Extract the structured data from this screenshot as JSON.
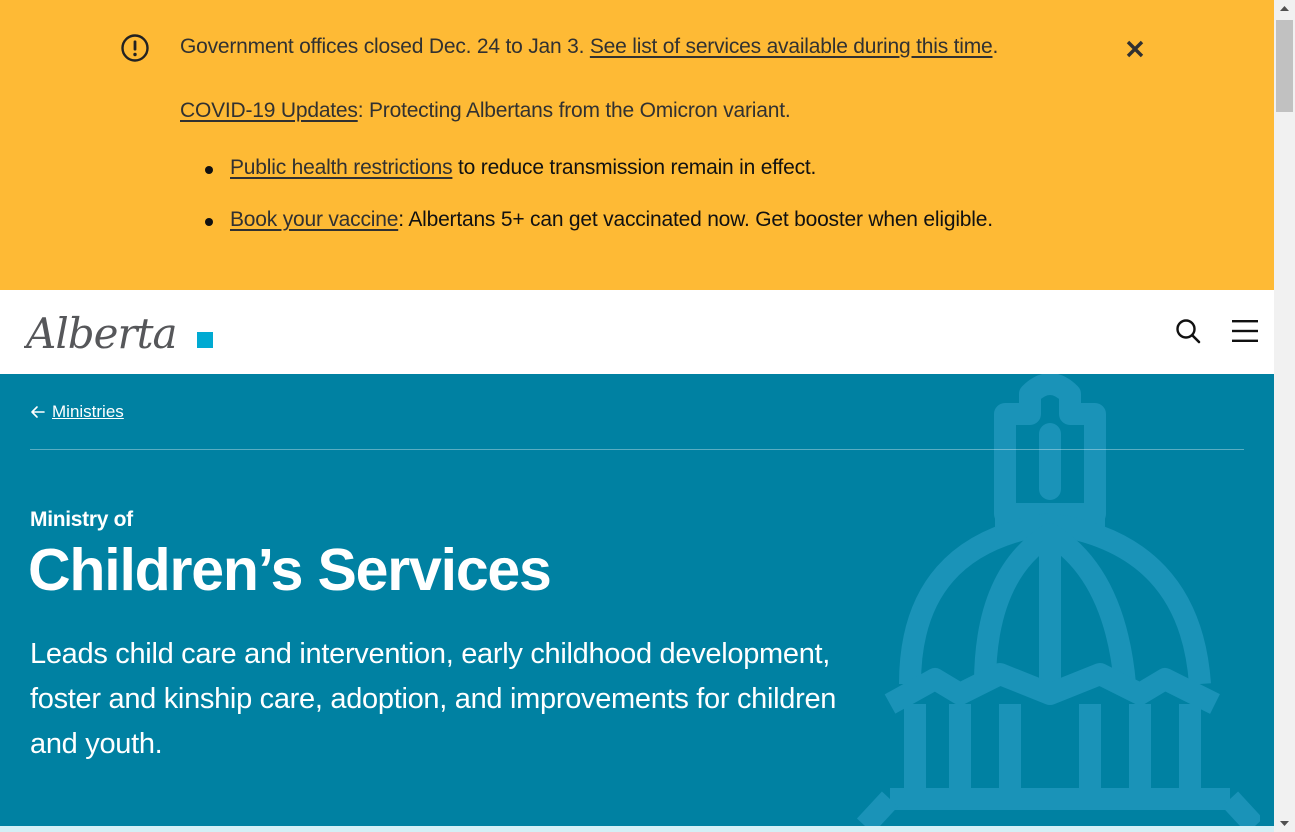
{
  "alert": {
    "closed_text": "Government offices closed Dec. 24 to Jan 3. ",
    "services_link": "See list of services available during this time",
    "closed_end": ".",
    "covid_link": "COVID-19 Updates",
    "covid_text": ": Protecting Albertans from the Omicron variant.",
    "bullets": [
      {
        "link": "Public health restrictions",
        "text": " to reduce transmission remain in effect."
      },
      {
        "link": "Book your vaccine",
        "text": ": Albertans 5+ can get vaccinated now. Get booster when eligible."
      }
    ],
    "icon": "exclamation-circle-icon",
    "close_icon": "close-icon"
  },
  "header": {
    "logo_text": "Alberta",
    "search_icon": "search-icon",
    "menu_icon": "hamburger-menu-icon"
  },
  "hero": {
    "breadcrumb": "Ministries",
    "kicker": "Ministry of",
    "title": "Children’s Services",
    "lead": "Leads child care and intervention, early childhood development, foster and kinship care, adoption, and improvements for children and youth.",
    "background_icon": "legislature-dome-icon"
  },
  "colors": {
    "alert_bg": "#feba35",
    "hero_bg": "#0081a2",
    "logo_accent": "#00aad2",
    "text_dark": "#313131"
  }
}
